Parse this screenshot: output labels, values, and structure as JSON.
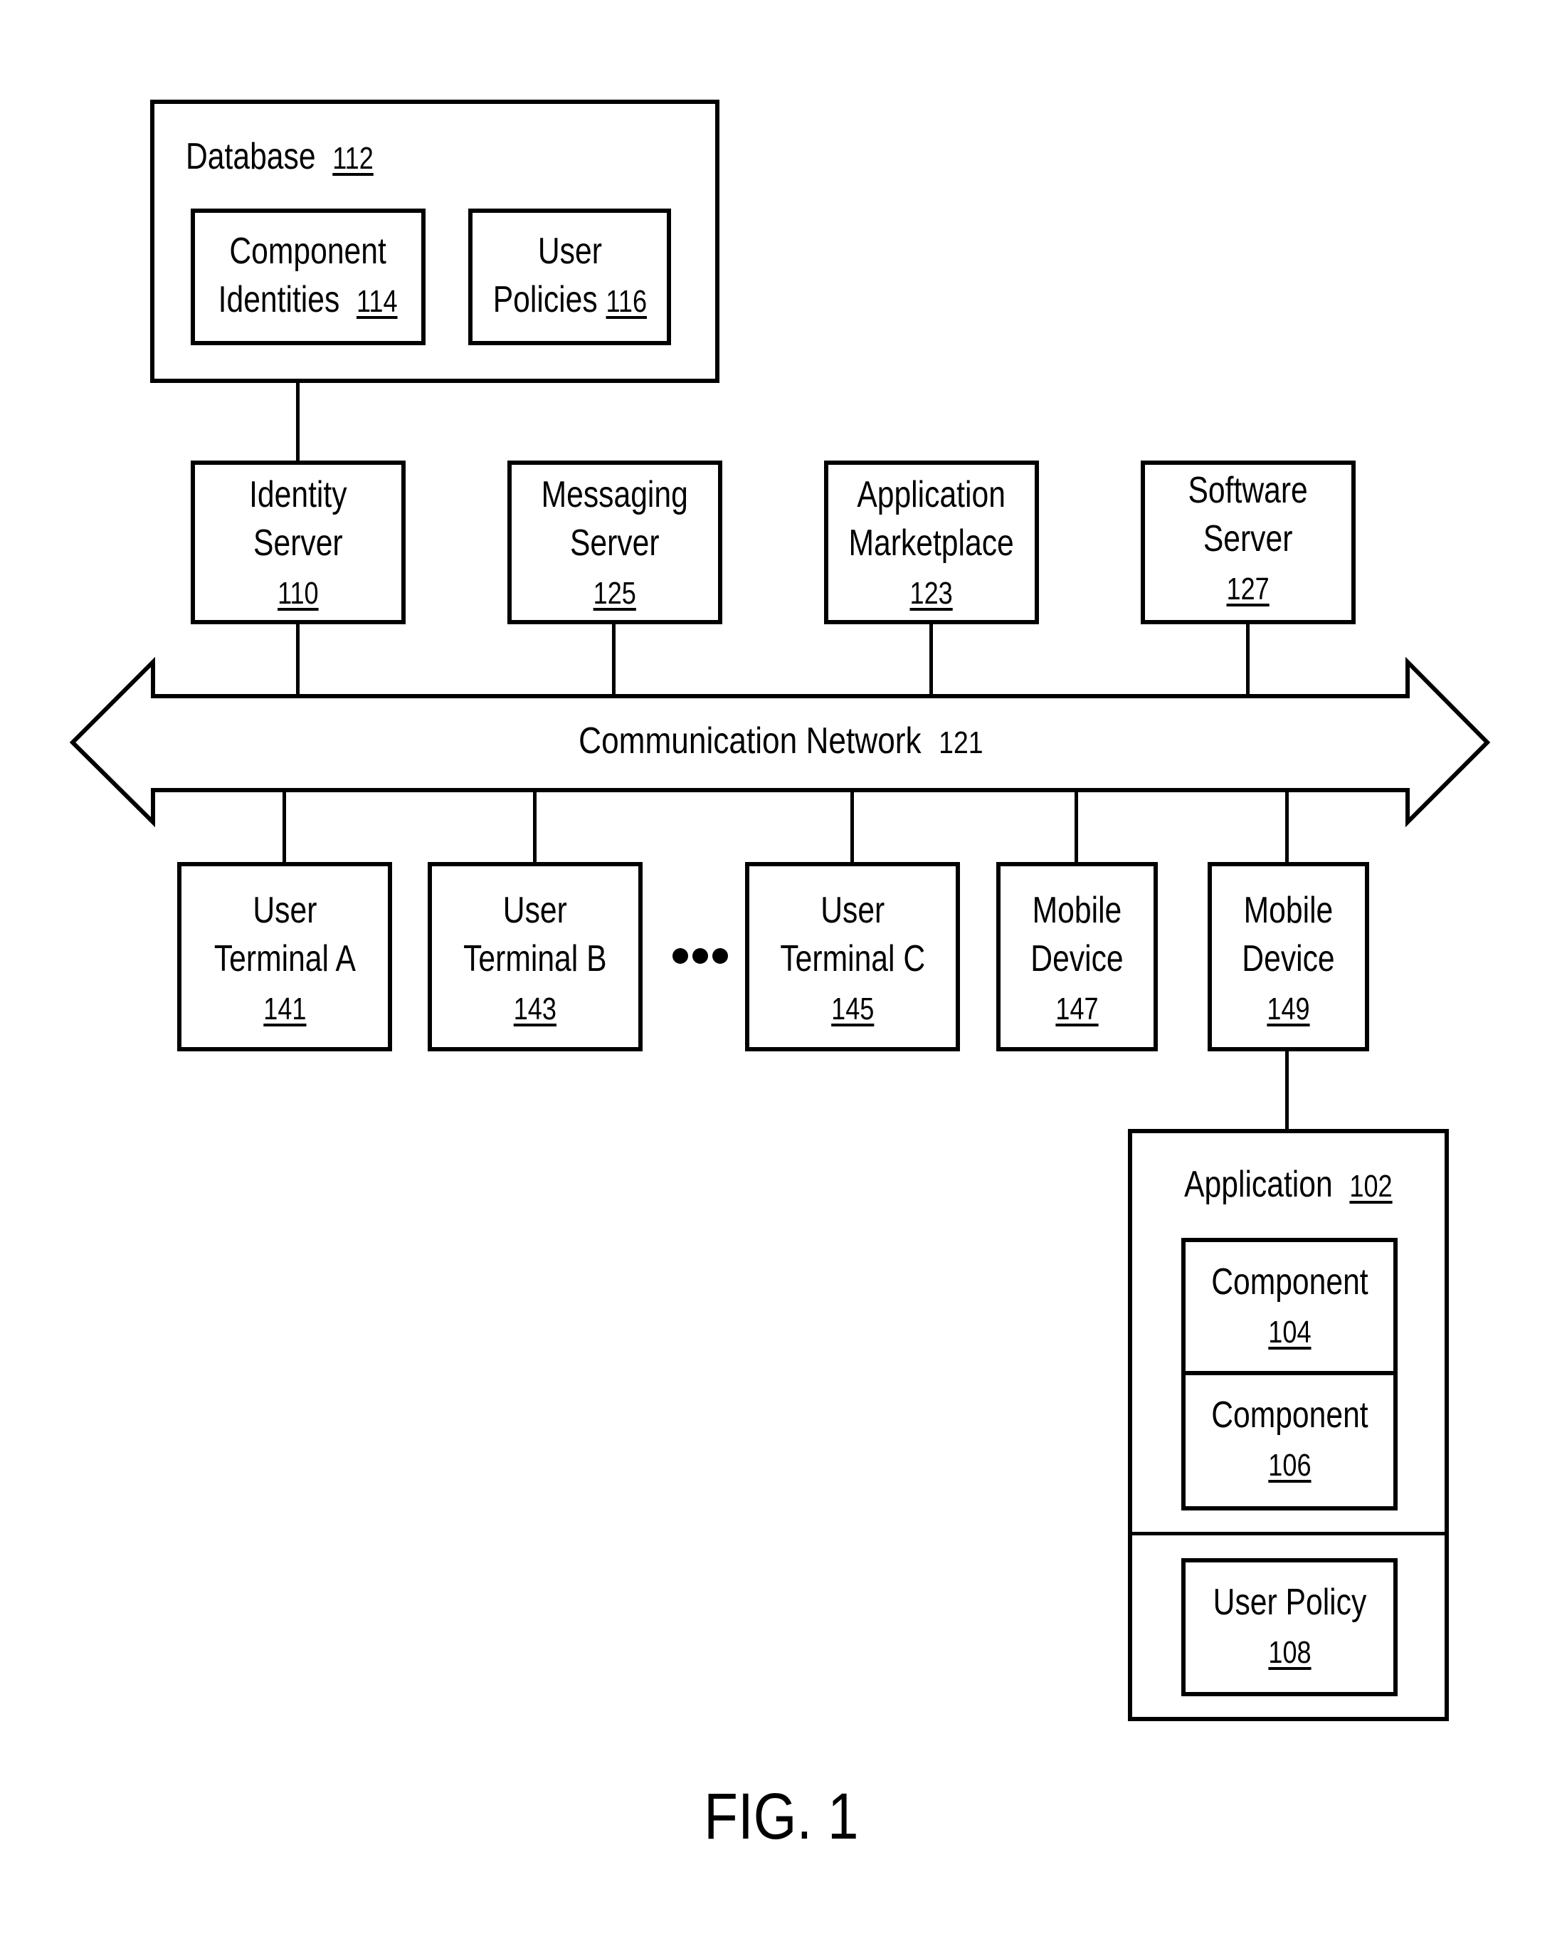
{
  "figure": {
    "caption": "FIG. 1"
  },
  "database": {
    "title": "Database",
    "ref": "112",
    "children": [
      {
        "lines": [
          "Component",
          "Identities"
        ],
        "ref": "114"
      },
      {
        "lines": [
          "User",
          "Policies"
        ],
        "ref": "116"
      }
    ]
  },
  "servers": [
    {
      "lines": [
        "Identity",
        "Server"
      ],
      "ref": "110"
    },
    {
      "lines": [
        "Messaging",
        "Server"
      ],
      "ref": "125"
    },
    {
      "lines": [
        "Application",
        "Marketplace"
      ],
      "ref": "123"
    },
    {
      "lines": [
        "Software",
        "Server"
      ],
      "ref": "127"
    }
  ],
  "network": {
    "label": "Communication Network",
    "ref": "121"
  },
  "clients": [
    {
      "lines": [
        "User",
        "Terminal A"
      ],
      "ref": "141"
    },
    {
      "lines": [
        "User",
        "Terminal B"
      ],
      "ref": "143"
    },
    {
      "lines": [
        "User",
        "Terminal C"
      ],
      "ref": "145"
    },
    {
      "lines": [
        "Mobile",
        "Device"
      ],
      "ref": "147"
    },
    {
      "lines": [
        "Mobile",
        "Device"
      ],
      "ref": "149"
    }
  ],
  "ellipsis": {
    "icon": "ellipsis-icon"
  },
  "application": {
    "title": "Application",
    "ref": "102",
    "components": [
      {
        "label": "Component",
        "ref": "104"
      },
      {
        "label": "Component",
        "ref": "106"
      }
    ],
    "policy": {
      "label": "User Policy",
      "ref": "108"
    }
  }
}
